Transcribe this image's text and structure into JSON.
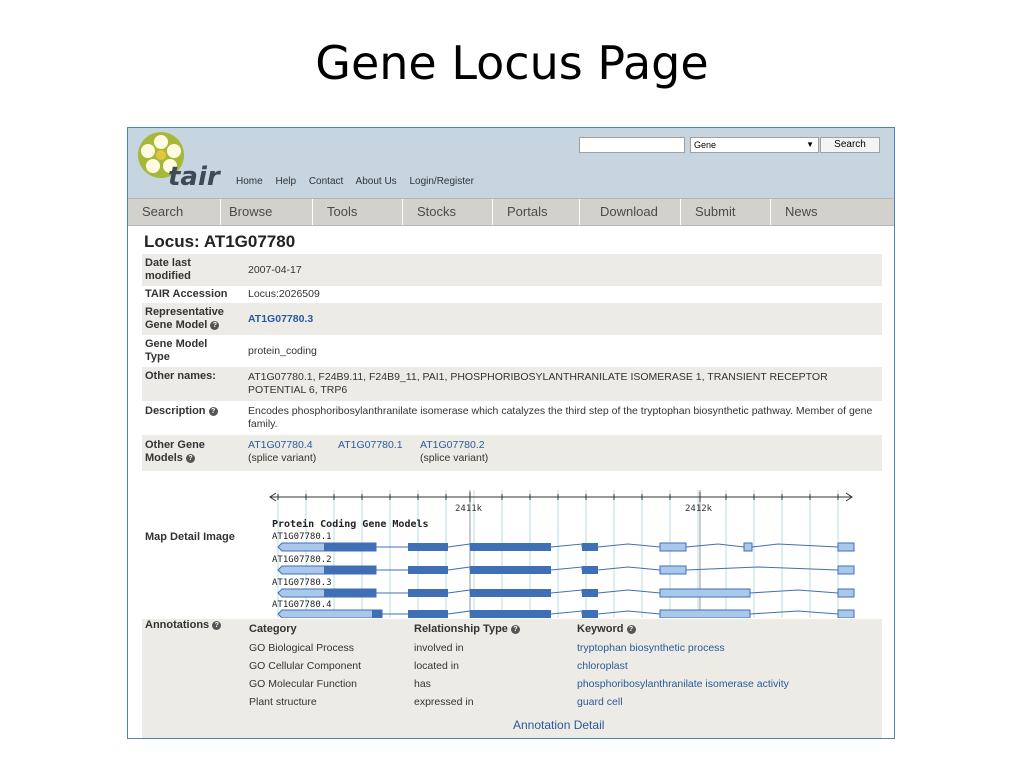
{
  "slide_title": "Gene Locus Page",
  "header": {
    "logo_text": "tair",
    "top_nav": [
      "Home",
      "Help",
      "Contact",
      "About Us",
      "Login/Register"
    ],
    "search": {
      "input_value": "",
      "select_value": "Gene",
      "button_label": "Search"
    }
  },
  "main_nav": [
    "Search",
    "Browse",
    "Tools",
    "Stocks",
    "Portals",
    "Download",
    "Submit",
    "News"
  ],
  "locus": {
    "title": "Locus: AT1G07780",
    "date_last_modified_label": "Date last modified",
    "date_last_modified": "2007-04-17",
    "tair_accession_label": "TAIR Accession",
    "tair_accession": "Locus:2026509",
    "representative_gene_model_label": "Representative Gene Model",
    "representative_gene_model": "AT1G07780.3",
    "gene_model_type_label": "Gene Model Type",
    "gene_model_type": "protein_coding",
    "other_names_label": "Other names:",
    "other_names": "AT1G07780.1, F24B9.11, F24B9_11, PAI1, PHOSPHORIBOSYLANTHRANILATE ISOMERASE 1, TRANSIENT RECEPTOR POTENTIAL 6, TRP6",
    "description_label": "Description",
    "description": "Encodes phosphoribosylanthranilate isomerase which catalyzes the third step of the tryptophan biosynthetic pathway. Member of gene family.",
    "other_gene_models_label": "Other Gene Models",
    "other_gene_models": [
      {
        "id": "AT1G07780.4",
        "note": "(splice variant)"
      },
      {
        "id": "AT1G07780.1",
        "note": ""
      },
      {
        "id": "AT1G07780.2",
        "note": "(splice variant)"
      }
    ],
    "map_detail_label": "Map Detail Image"
  },
  "map": {
    "ticks": [
      "2411k",
      "2412k"
    ],
    "track_title": "Protein Coding Gene Models",
    "models": [
      "AT1G07780.1",
      "AT1G07780.2",
      "AT1G07780.3",
      "AT1G07780.4"
    ]
  },
  "annotations": {
    "label": "Annotations",
    "headers": [
      "Category",
      "Relationship Type",
      "Keyword"
    ],
    "rows": [
      [
        "GO Biological Process",
        "involved in",
        "tryptophan biosynthetic process"
      ],
      [
        "GO Cellular Component",
        "located in",
        "chloroplast"
      ],
      [
        "GO Molecular Function",
        "has",
        "phosphoribosylanthranilate isomerase activity"
      ],
      [
        "Plant structure",
        "expressed in",
        "guard cell"
      ]
    ],
    "detail_link": "Annotation Detail"
  },
  "colors": {
    "link": "#2a5a9a",
    "exon": "#3f6fb5",
    "exon_light": "#a9c8ec",
    "header_bg": "#c6d5e0"
  }
}
